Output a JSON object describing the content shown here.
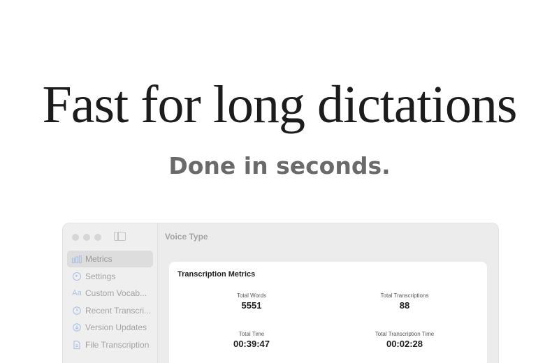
{
  "hero": {
    "headline": "Fast for long dictations",
    "subhead": "Done in seconds."
  },
  "window": {
    "title": "Voice Type",
    "sidebar": {
      "items": [
        {
          "label": "Metrics",
          "icon": "bar-chart-icon",
          "active": true
        },
        {
          "label": "Settings",
          "icon": "settings-icon",
          "active": false
        },
        {
          "label": "Custom Vocab...",
          "icon": "text-aa-icon",
          "active": false
        },
        {
          "label": "Recent Transcri...",
          "icon": "clock-icon",
          "active": false
        },
        {
          "label": "Version Updates",
          "icon": "download-icon",
          "active": false
        },
        {
          "label": "File Transcription",
          "icon": "document-icon",
          "active": false
        }
      ]
    },
    "card": {
      "title": "Transcription Metrics",
      "metrics": [
        {
          "label": "Total Words",
          "value": "5551"
        },
        {
          "label": "Total Transcriptions",
          "value": "88"
        },
        {
          "label": "Total Time",
          "value": "00:39:47"
        },
        {
          "label": "Total Transcription Time",
          "value": "00:02:28"
        }
      ]
    }
  },
  "colors": {
    "accent_icon": "#a9c2e3",
    "headline": "#1c1c1c",
    "subhead": "#6a6a6a"
  }
}
